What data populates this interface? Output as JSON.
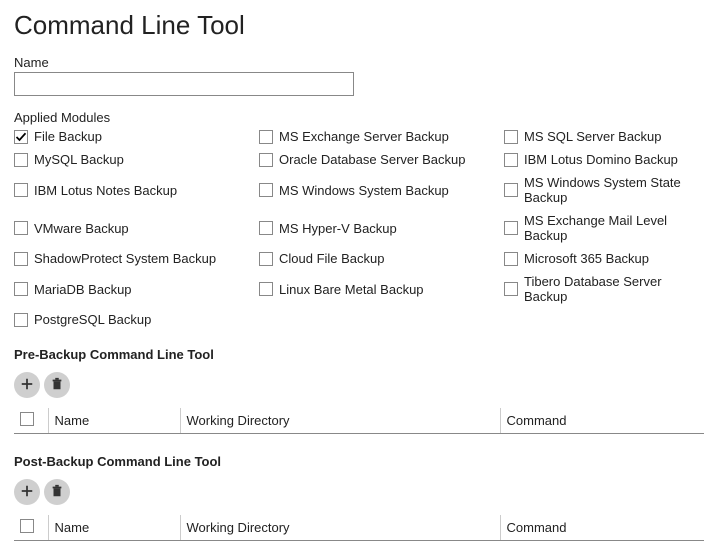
{
  "title": "Command Line Tool",
  "nameField": {
    "label": "Name",
    "value": ""
  },
  "modules": {
    "label": "Applied Modules",
    "items": [
      {
        "label": "File Backup",
        "checked": true
      },
      {
        "label": "MS Exchange Server Backup",
        "checked": false
      },
      {
        "label": "MS SQL Server Backup",
        "checked": false
      },
      {
        "label": "MySQL Backup",
        "checked": false
      },
      {
        "label": "Oracle Database Server Backup",
        "checked": false
      },
      {
        "label": "IBM Lotus Domino Backup",
        "checked": false
      },
      {
        "label": "IBM Lotus Notes Backup",
        "checked": false
      },
      {
        "label": "MS Windows System Backup",
        "checked": false
      },
      {
        "label": "MS Windows System State Backup",
        "checked": false
      },
      {
        "label": "VMware Backup",
        "checked": false
      },
      {
        "label": "MS Hyper-V Backup",
        "checked": false
      },
      {
        "label": "MS Exchange Mail Level Backup",
        "checked": false
      },
      {
        "label": "ShadowProtect System Backup",
        "checked": false
      },
      {
        "label": "Cloud File Backup",
        "checked": false
      },
      {
        "label": "Microsoft 365 Backup",
        "checked": false
      },
      {
        "label": "MariaDB Backup",
        "checked": false
      },
      {
        "label": "Linux Bare Metal Backup",
        "checked": false
      },
      {
        "label": "Tibero Database Server Backup",
        "checked": false
      },
      {
        "label": "PostgreSQL Backup",
        "checked": false
      }
    ]
  },
  "preBackup": {
    "title": "Pre-Backup Command Line Tool",
    "columns": {
      "name": "Name",
      "workingDir": "Working Directory",
      "command": "Command"
    },
    "rows": []
  },
  "postBackup": {
    "title": "Post-Backup Command Line Tool",
    "columns": {
      "name": "Name",
      "workingDir": "Working Directory",
      "command": "Command"
    },
    "rows": []
  }
}
